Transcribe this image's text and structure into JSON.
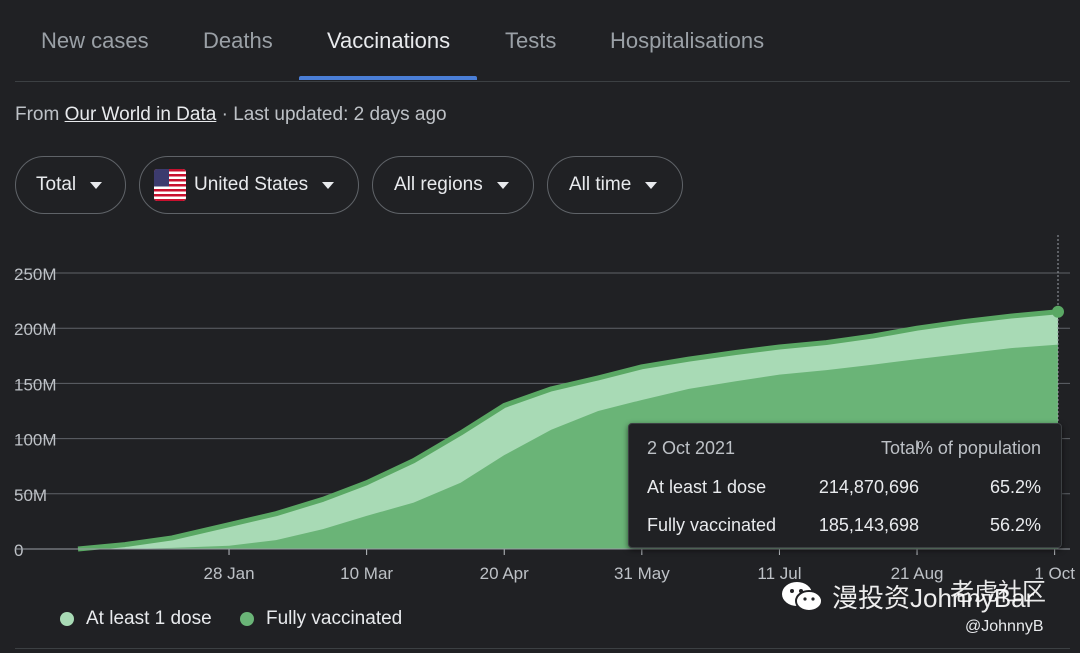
{
  "tabs": [
    {
      "label": "New cases"
    },
    {
      "label": "Deaths"
    },
    {
      "label": "Vaccinations"
    },
    {
      "label": "Tests"
    },
    {
      "label": "Hospitalisations"
    }
  ],
  "active_tab": "Vaccinations",
  "source": {
    "prefix": "From ",
    "link": "Our World in Data",
    "suffix": " · Last updated: 2 days ago"
  },
  "filters": {
    "metric": "Total",
    "country": "United States",
    "region": "All regions",
    "period": "All time"
  },
  "colors": {
    "accent": "#4a7ed6",
    "at_least_one": "#a8dab5",
    "fully": "#6ab477",
    "line": "#5aa864"
  },
  "tooltip": {
    "date": "2 Oct 2021",
    "col_total": "Total",
    "col_pct": "% of population",
    "rows": [
      {
        "label": "At least 1 dose",
        "total": "214,870,696",
        "pct": "65.2%"
      },
      {
        "label": "Fully vaccinated",
        "total": "185,143,698",
        "pct": "56.2%"
      }
    ]
  },
  "legend": [
    {
      "label": "At least 1 dose"
    },
    {
      "label": "Fully vaccinated"
    }
  ],
  "watermark": {
    "text": "漫投资JohnnyBar",
    "brand": "老虎社区",
    "handle": "@JohnnyB"
  },
  "chart_data": {
    "type": "area",
    "x_ticks": [
      "28 Jan",
      "10 Mar",
      "20 Apr",
      "31 May",
      "11 Jul",
      "21 Aug",
      "1 Oct"
    ],
    "y_ticks": [
      "0",
      "50M",
      "100M",
      "150M",
      "200M",
      "250M"
    ],
    "ylim": [
      0,
      250000000
    ],
    "x": [
      "2020-12-14",
      "2020-12-28",
      "2021-01-11",
      "2021-01-28",
      "2021-02-11",
      "2021-02-25",
      "2021-03-10",
      "2021-03-24",
      "2021-04-07",
      "2021-04-20",
      "2021-05-04",
      "2021-05-18",
      "2021-05-31",
      "2021-06-14",
      "2021-06-28",
      "2021-07-11",
      "2021-07-25",
      "2021-08-08",
      "2021-08-21",
      "2021-09-04",
      "2021-09-18",
      "2021-10-02"
    ],
    "series": [
      {
        "name": "At least 1 dose",
        "values": [
          0,
          4000000,
          10000000,
          22000000,
          32000000,
          45000000,
          60000000,
          80000000,
          105000000,
          130000000,
          145000000,
          155000000,
          165000000,
          172000000,
          178000000,
          183000000,
          187000000,
          193000000,
          200000000,
          206000000,
          211000000,
          214870696
        ]
      },
      {
        "name": "Fully vaccinated",
        "values": [
          0,
          0,
          1000000,
          3000000,
          8000000,
          18000000,
          30000000,
          42000000,
          60000000,
          85000000,
          108000000,
          125000000,
          135000000,
          145000000,
          152000000,
          158000000,
          162000000,
          167000000,
          172000000,
          177000000,
          182000000,
          185143698
        ]
      }
    ]
  }
}
